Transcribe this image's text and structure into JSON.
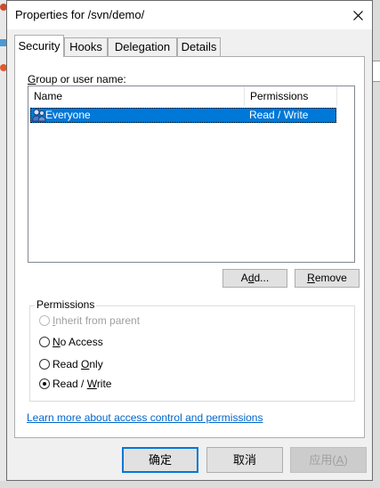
{
  "window": {
    "title": "Properties for /svn/demo/",
    "close_icon": "close-icon"
  },
  "tabs": [
    {
      "label": "Security",
      "active": true
    },
    {
      "label": "Hooks",
      "active": false
    },
    {
      "label": "Delegation",
      "active": false
    },
    {
      "label": "Details",
      "active": false
    }
  ],
  "security": {
    "group_label": "Group or user name:",
    "columns": [
      "Name",
      "Permissions"
    ],
    "rows": [
      {
        "icon": "group-icon",
        "name": "Everyone",
        "permission": "Read / Write",
        "selected": true
      }
    ],
    "add_button": "Add...",
    "remove_button": "Remove",
    "permissions_legend": "Permissions",
    "options": [
      {
        "label": "Inherit from parent",
        "checked": false,
        "enabled": false
      },
      {
        "label": "No Access",
        "checked": false,
        "enabled": true
      },
      {
        "label": "Read Only",
        "checked": false,
        "enabled": true
      },
      {
        "label": "Read / Write",
        "checked": true,
        "enabled": true
      }
    ],
    "help_link": "Learn more about access control and permissions"
  },
  "footer": {
    "ok": "确定",
    "cancel": "取消",
    "apply": "应用(A)"
  },
  "colors": {
    "selection": "#0078d7",
    "link": "#0066cc",
    "primary_border": "#0078d7"
  }
}
